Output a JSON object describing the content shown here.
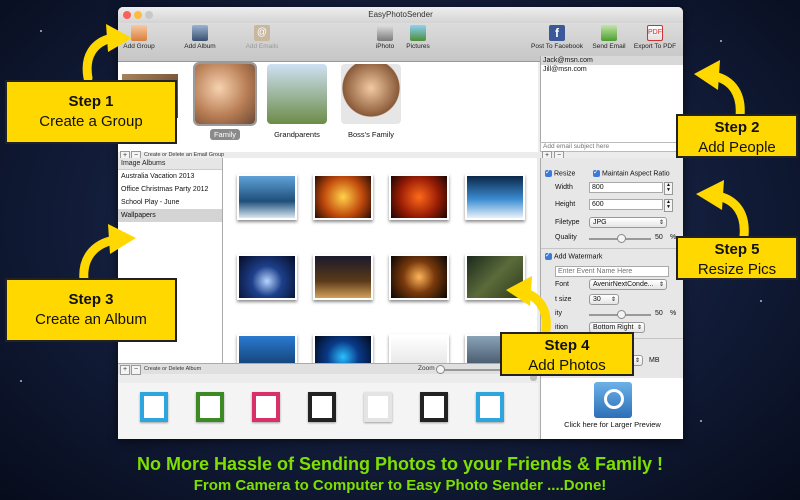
{
  "window": {
    "title": "EasyPhotoSender"
  },
  "toolbar": {
    "add_group": "Add Group",
    "add_album": "Add Album",
    "add_emails": "Add Emails",
    "iphoto": "iPhoto",
    "pictures": "Pictures",
    "post_facebook": "Post To Facebook",
    "send_email": "Send Email",
    "export_pdf": "Export To PDF"
  },
  "groups": {
    "items": [
      {
        "label": "Family"
      },
      {
        "label": "Grandparents"
      },
      {
        "label": "Boss's Family"
      }
    ],
    "footer_label": "Create or Delete an Email Group"
  },
  "emails": {
    "items": [
      "Jack@msn.com",
      "Jill@msn.com"
    ],
    "subject_placeholder": "Add email subject here"
  },
  "albums": {
    "header": "Image Albums",
    "items": [
      "Australia Vacation 2013",
      "Office Christmas Party 2012",
      "School Play - June",
      "Wallpapers"
    ],
    "footer_label": "Create or Delete Album"
  },
  "zoom": {
    "label": "Zoom"
  },
  "settings": {
    "resize_label": "Resize",
    "aspect_label": "Maintain Aspect Ratio",
    "width_label": "Width",
    "width_value": "800",
    "height_label": "Height",
    "height_value": "600",
    "filetype_label": "Filetype",
    "filetype_value": "JPG",
    "quality_label": "Quality",
    "quality_value": "50",
    "quality_pct": "%",
    "watermark_label": "Add Watermark",
    "event_placeholder": "Enter Event Name Here",
    "font_label": "Font",
    "font_value": "AvenirNextConde...",
    "font_size_label": "t size",
    "font_size_value": "30",
    "opacity_label": "ity",
    "opacity_value": "50",
    "opacity_pct": "%",
    "position_label": "ition",
    "position_value": "Bottom Right",
    "photos_label": "otos",
    "size_label": "to",
    "size_value": "5",
    "size_unit": "MB"
  },
  "preview": {
    "label": "Click here for Larger Preview"
  },
  "callouts": {
    "step1_a": "Step 1",
    "step1_b": "Create a Group",
    "step2_a": "Step 2",
    "step2_b": "Add People",
    "step3_a": "Step 3",
    "step3_b": "Create an Album",
    "step4_a": "Step 4",
    "step4_b": "Add Photos",
    "step5_a": "Step 5",
    "step5_b": "Resize Pics"
  },
  "tagline": {
    "line1": "No More Hassle of Sending Photos to your Friends & Family !",
    "line2": "From Camera to Computer to Easy Photo Sender ....Done!"
  },
  "colors": {
    "callout": "#ffd800",
    "tagline": "#7ee000"
  }
}
